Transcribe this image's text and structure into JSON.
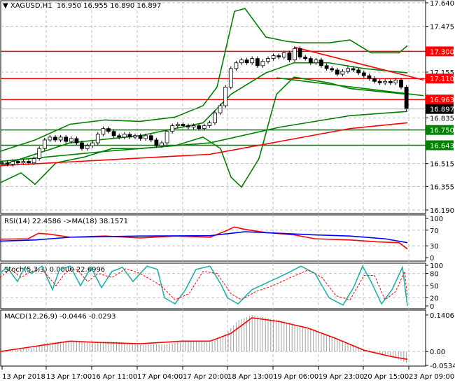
{
  "header": {
    "symbol": "XAGUSD,H1",
    "ohlc": "16.950 16.955 16.890 16.897"
  },
  "chart_data": [
    {
      "type": "candlestick",
      "title": "XAGUSD,H1",
      "ylim": [
        16.19,
        17.64
      ],
      "yticks": [
        "17.640",
        "17.475",
        "17.155",
        "16.835",
        "16.515",
        "16.355",
        "16.190"
      ],
      "closes": [
        16.52,
        16.51,
        16.53,
        16.52,
        16.53,
        16.52,
        16.55,
        16.62,
        16.68,
        16.7,
        16.68,
        16.7,
        16.67,
        16.69,
        16.66,
        16.62,
        16.64,
        16.66,
        16.72,
        16.76,
        16.74,
        16.71,
        16.7,
        16.72,
        16.7,
        16.71,
        16.69,
        16.71,
        16.68,
        16.64,
        16.66,
        16.74,
        16.78,
        16.79,
        16.78,
        16.77,
        16.78,
        16.76,
        16.78,
        16.8,
        16.87,
        16.92,
        17.05,
        17.18,
        17.22,
        17.24,
        17.22,
        17.25,
        17.2,
        17.23,
        17.25,
        17.27,
        17.26,
        17.29,
        17.24,
        17.32,
        17.26,
        17.25,
        17.22,
        17.24,
        17.2,
        17.18,
        17.17,
        17.14,
        17.16,
        17.18,
        17.17,
        17.15,
        17.13,
        17.11,
        17.09,
        17.08,
        17.09,
        17.08,
        17.1,
        17.05,
        16.897
      ],
      "levels": [
        {
          "value": "17.300",
          "color": "#ff0000"
        },
        {
          "value": "17.110",
          "color": "#ff0000"
        },
        {
          "value": "16.963",
          "color": "#ff0000"
        },
        {
          "value": "16.750",
          "color": "#008000"
        },
        {
          "value": "16.643",
          "color": "#008000"
        }
      ],
      "current_price": "16.897",
      "lines": [
        {
          "name": "bollinger-upper",
          "color": "#008000",
          "pts": [
            [
              0,
              16.6
            ],
            [
              50,
              16.68
            ],
            [
              100,
              16.79
            ],
            [
              150,
              16.82
            ],
            [
              200,
              16.81
            ],
            [
              250,
              16.84
            ],
            [
              290,
              16.92
            ],
            [
              310,
              17.05
            ],
            [
              335,
              17.58
            ],
            [
              350,
              17.6
            ],
            [
              380,
              17.4
            ],
            [
              410,
              17.37
            ],
            [
              430,
              17.36
            ],
            [
              470,
              17.36
            ],
            [
              500,
              17.38
            ],
            [
              530,
              17.29
            ],
            [
              570,
              17.29
            ],
            [
              582,
              17.34
            ]
          ]
        },
        {
          "name": "bollinger-lower",
          "color": "#008000",
          "pts": [
            [
              0,
              16.38
            ],
            [
              30,
              16.45
            ],
            [
              50,
              16.37
            ],
            [
              80,
              16.52
            ],
            [
              120,
              16.56
            ],
            [
              160,
              16.62
            ],
            [
              200,
              16.62
            ],
            [
              250,
              16.64
            ],
            [
              290,
              16.7
            ],
            [
              315,
              16.62
            ],
            [
              330,
              16.42
            ],
            [
              345,
              16.35
            ],
            [
              370,
              16.55
            ],
            [
              395,
              17.0
            ],
            [
              420,
              17.12
            ],
            [
              470,
              17.08
            ],
            [
              500,
              17.04
            ],
            [
              540,
              17.02
            ],
            [
              582,
              17.0
            ]
          ]
        },
        {
          "name": "bollinger-middle",
          "color": "#008000",
          "pts": [
            [
              0,
              16.5
            ],
            [
              100,
              16.66
            ],
            [
              200,
              16.71
            ],
            [
              290,
              16.8
            ],
            [
              330,
              17.0
            ],
            [
              380,
              17.15
            ],
            [
              420,
              17.22
            ],
            [
              470,
              17.22
            ],
            [
              520,
              17.18
            ],
            [
              582,
              17.15
            ]
          ]
        },
        {
          "name": "ma-green-long",
          "color": "#008000",
          "pts": [
            [
              0,
              16.53
            ],
            [
              150,
              16.6
            ],
            [
              300,
              16.66
            ],
            [
              400,
              16.77
            ],
            [
              500,
              16.85
            ],
            [
              582,
              16.88
            ]
          ]
        },
        {
          "name": "ma-red-long",
          "color": "#ff0000",
          "pts": [
            [
              0,
              16.5
            ],
            [
              150,
              16.54
            ],
            [
              300,
              16.58
            ],
            [
              400,
              16.67
            ],
            [
              500,
              16.76
            ],
            [
              582,
              16.8
            ]
          ]
        },
        {
          "name": "trendline-green",
          "color": "#008000",
          "pts": [
            [
              395,
              17.115
            ],
            [
              605,
              16.99
            ]
          ]
        },
        {
          "name": "trendline-red",
          "color": "#ff0000",
          "pts": [
            [
              420,
              17.33
            ],
            [
              605,
              17.1
            ]
          ]
        }
      ]
    },
    {
      "type": "line",
      "title": "RSI(14) 22.4586  ->MA(18) 38.1571",
      "ylim": [
        0,
        100
      ],
      "yticks": [
        "100",
        "70",
        "30",
        "0"
      ],
      "series": [
        {
          "name": "RSI",
          "color": "#ff0000",
          "pts": [
            [
              0,
              47
            ],
            [
              40,
              48
            ],
            [
              55,
              62
            ],
            [
              70,
              60
            ],
            [
              100,
              52
            ],
            [
              150,
              55
            ],
            [
              200,
              50
            ],
            [
              250,
              55
            ],
            [
              300,
              52
            ],
            [
              320,
              66
            ],
            [
              335,
              78
            ],
            [
              350,
              72
            ],
            [
              380,
              64
            ],
            [
              420,
              58
            ],
            [
              450,
              48
            ],
            [
              500,
              45
            ],
            [
              540,
              40
            ],
            [
              570,
              38
            ],
            [
              582,
              22
            ]
          ]
        },
        {
          "name": "MA",
          "color": "#0000ff",
          "pts": [
            [
              0,
              42
            ],
            [
              50,
              45
            ],
            [
              100,
              52
            ],
            [
              200,
              55
            ],
            [
              300,
              56
            ],
            [
              350,
              66
            ],
            [
              400,
              62
            ],
            [
              450,
              58
            ],
            [
              500,
              55
            ],
            [
              550,
              48
            ],
            [
              582,
              38
            ]
          ]
        }
      ]
    },
    {
      "type": "line",
      "title": "Stoch(5,3,3) 0.0000 22.6996",
      "ylim": [
        0,
        100
      ],
      "yticks": [
        "100",
        "80",
        "50",
        "20",
        "0"
      ],
      "series": [
        {
          "name": "main",
          "color": "#20b2aa",
          "pts": [
            [
              0,
              80
            ],
            [
              10,
              95
            ],
            [
              25,
              60
            ],
            [
              35,
              95
            ],
            [
              45,
              80
            ],
            [
              60,
              98
            ],
            [
              75,
              40
            ],
            [
              85,
              90
            ],
            [
              100,
              98
            ],
            [
              115,
              50
            ],
            [
              130,
              95
            ],
            [
              145,
              45
            ],
            [
              160,
              85
            ],
            [
              175,
              95
            ],
            [
              190,
              60
            ],
            [
              210,
              98
            ],
            [
              225,
              90
            ],
            [
              235,
              20
            ],
            [
              250,
              5
            ],
            [
              265,
              40
            ],
            [
              280,
              90
            ],
            [
              300,
              98
            ],
            [
              315,
              55
            ],
            [
              325,
              20
            ],
            [
              340,
              5
            ],
            [
              360,
              40
            ],
            [
              385,
              60
            ],
            [
              410,
              80
            ],
            [
              430,
              98
            ],
            [
              450,
              80
            ],
            [
              470,
              20
            ],
            [
              490,
              2
            ],
            [
              505,
              45
            ],
            [
              518,
              98
            ],
            [
              530,
              60
            ],
            [
              545,
              5
            ],
            [
              560,
              40
            ],
            [
              575,
              95
            ],
            [
              582,
              0
            ]
          ]
        },
        {
          "name": "signal",
          "color": "#ff0000",
          "pts": [
            [
              0,
              70
            ],
            [
              15,
              90
            ],
            [
              30,
              70
            ],
            [
              45,
              85
            ],
            [
              60,
              90
            ],
            [
              80,
              50
            ],
            [
              95,
              85
            ],
            [
              110,
              90
            ],
            [
              125,
              60
            ],
            [
              140,
              80
            ],
            [
              160,
              70
            ],
            [
              180,
              92
            ],
            [
              200,
              80
            ],
            [
              230,
              50
            ],
            [
              250,
              15
            ],
            [
              270,
              30
            ],
            [
              290,
              85
            ],
            [
              310,
              80
            ],
            [
              330,
              30
            ],
            [
              345,
              15
            ],
            [
              365,
              35
            ],
            [
              390,
              50
            ],
            [
              415,
              70
            ],
            [
              440,
              88
            ],
            [
              460,
              70
            ],
            [
              480,
              25
            ],
            [
              500,
              15
            ],
            [
              520,
              75
            ],
            [
              535,
              75
            ],
            [
              550,
              15
            ],
            [
              565,
              35
            ],
            [
              578,
              85
            ],
            [
              582,
              22
            ]
          ]
        }
      ]
    },
    {
      "type": "bar",
      "title": "MACD(12,26,9) -0.0446 -0.0293",
      "ylim": [
        -0.0534,
        0.1406
      ],
      "yticks": [
        "0.1406",
        "0.00",
        "-0.0534"
      ],
      "histogram": [
        [
          0,
          0.0
        ],
        [
          40,
          0.01
        ],
        [
          70,
          0.035
        ],
        [
          100,
          0.04
        ],
        [
          130,
          0.035
        ],
        [
          160,
          0.04
        ],
        [
          200,
          0.025
        ],
        [
          240,
          0.03
        ],
        [
          270,
          0.04
        ],
        [
          300,
          0.035
        ],
        [
          320,
          0.06
        ],
        [
          340,
          0.12
        ],
        [
          360,
          0.14
        ],
        [
          400,
          0.12
        ],
        [
          440,
          0.09
        ],
        [
          480,
          0.05
        ],
        [
          520,
          0.01
        ],
        [
          560,
          -0.02
        ],
        [
          582,
          -0.045
        ]
      ],
      "signal": [
        [
          0,
          0.0
        ],
        [
          50,
          0.02
        ],
        [
          100,
          0.04
        ],
        [
          140,
          0.035
        ],
        [
          200,
          0.03
        ],
        [
          260,
          0.04
        ],
        [
          300,
          0.04
        ],
        [
          330,
          0.07
        ],
        [
          360,
          0.13
        ],
        [
          400,
          0.115
        ],
        [
          440,
          0.09
        ],
        [
          480,
          0.05
        ],
        [
          520,
          0.005
        ],
        [
          560,
          -0.02
        ],
        [
          582,
          -0.03
        ]
      ]
    }
  ],
  "time_axis": [
    "13 Apr 2018",
    "13 Apr 17:00",
    "16 Apr 11:00",
    "17 Apr 04:00",
    "17 Apr 20:00",
    "18 Apr 13:00",
    "19 Apr 06:00",
    "19 Apr 23:00",
    "20 Apr 15:00",
    "23 Apr 09:00"
  ]
}
